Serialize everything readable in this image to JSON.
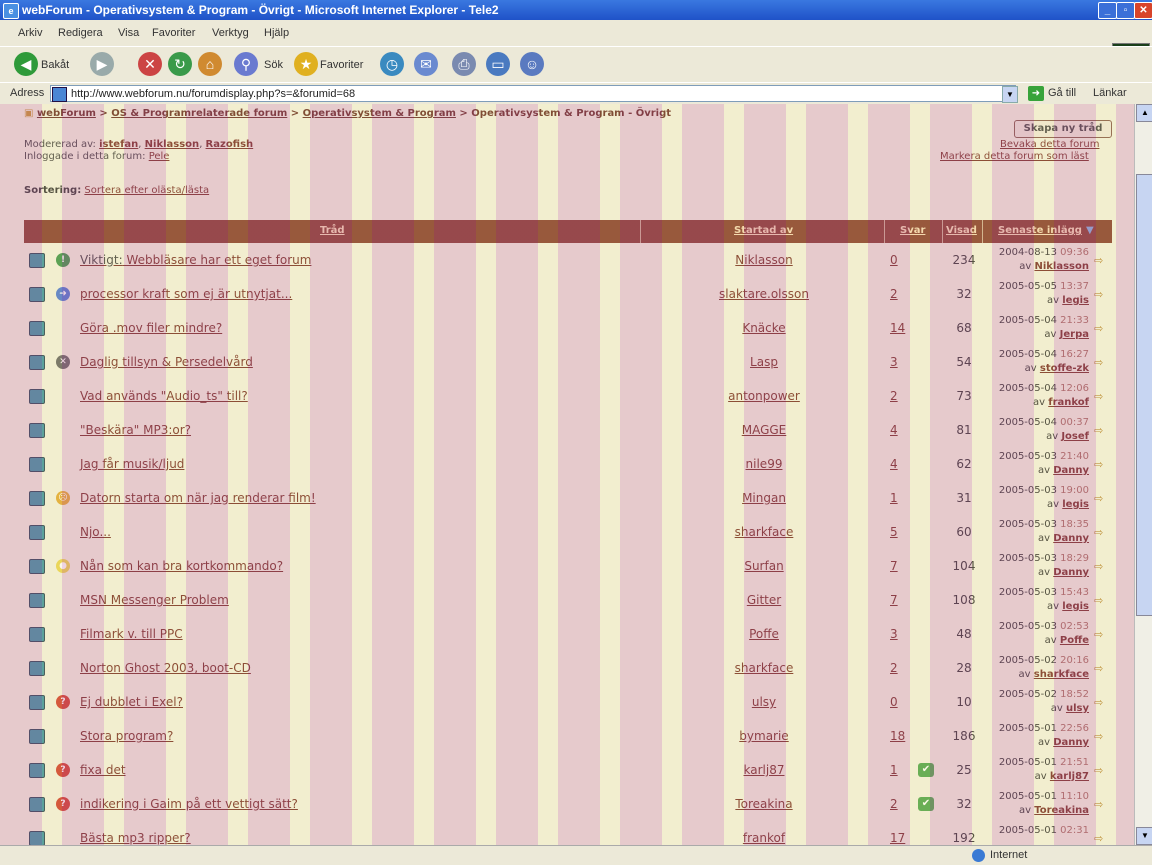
{
  "window": {
    "title": "webForum - Operativsystem & Program - Övrigt - Microsoft Internet Explorer - Tele2"
  },
  "menu": [
    "Arkiv",
    "Redigera",
    "Visa",
    "Favoriter",
    "Verktyg",
    "Hjälp"
  ],
  "toolbar": {
    "back_label": "Bakåt",
    "search_label": "Sök",
    "favorites_label": "Favoriter"
  },
  "address": {
    "label": "Adress",
    "url": "http://www.webforum.nu/forumdisplay.php?s=&forumid=68",
    "go_label": "Gå till",
    "links_label": "Länkar"
  },
  "breadcrumb": {
    "home": "webForum",
    "level1": "OS & Programrelaterade forum",
    "level2": "Operativsystem & Program",
    "current": "Operativsystem & Program - Övrigt"
  },
  "forum": {
    "moderated_label": "Modererad av:",
    "moderators": [
      "istefan",
      "Niklasson",
      "Razofish"
    ],
    "online_label": "Inloggade i detta forum:",
    "online_users": "Pele",
    "new_thread": "Skapa ny tråd",
    "watch_forum": "Bevaka detta forum",
    "mark_read": "Markera detta forum som läst",
    "sort_label": "Sortering:",
    "sort_value": "Sortera efter olästa/lästa"
  },
  "table": {
    "headers": {
      "thread": "Tråd",
      "started_by": "Startad av",
      "replies": "Svar",
      "views": "Visad",
      "last_post": "Senaste inlägg"
    },
    "rows": [
      {
        "icon": "exclaim-icon",
        "prefix": "Viktigt:",
        "title": "Webbläsare har ett eget forum",
        "starter": "Niklasson",
        "replies": "0",
        "views": "234",
        "date": "2004-08-13",
        "time": "09:36",
        "last_by": "Niklasson"
      },
      {
        "icon": "arrow-icon",
        "prefix": "",
        "title": "processor kraft som ej är utnytjat...",
        "starter": "slaktare.olsson",
        "replies": "2",
        "views": "32",
        "date": "2005-05-05",
        "time": "13:37",
        "last_by": "legis"
      },
      {
        "icon": "",
        "prefix": "",
        "title": "Göra .mov filer mindre?",
        "starter": "Knäcke",
        "replies": "14",
        "views": "68",
        "date": "2005-05-04",
        "time": "21:33",
        "last_by": "Jerpa"
      },
      {
        "icon": "tools-icon",
        "prefix": "",
        "title": "Daglig tillsyn & Persedelvård",
        "starter": "Lasp",
        "replies": "3",
        "views": "54",
        "date": "2005-05-04",
        "time": "16:27",
        "last_by": "stoffe-zk"
      },
      {
        "icon": "",
        "prefix": "",
        "title": "Vad används \"Audio_ts\" till?",
        "starter": "antonpower",
        "replies": "2",
        "views": "73",
        "date": "2005-05-04",
        "time": "12:06",
        "last_by": "frankof"
      },
      {
        "icon": "",
        "prefix": "",
        "title": "\"Beskära\" MP3:or?",
        "starter": "MAGGE",
        "replies": "4",
        "views": "81",
        "date": "2005-05-04",
        "time": "00:37",
        "last_by": "Josef"
      },
      {
        "icon": "",
        "prefix": "",
        "title": "Jag får musik/ljud",
        "starter": "nile99",
        "replies": "4",
        "views": "62",
        "date": "2005-05-03",
        "time": "21:40",
        "last_by": "Danny"
      },
      {
        "icon": "sad-icon",
        "prefix": "",
        "title": "Datorn starta om när jag renderar film!",
        "starter": "Mingan",
        "replies": "1",
        "views": "31",
        "date": "2005-05-03",
        "time": "19:00",
        "last_by": "legis"
      },
      {
        "icon": "",
        "prefix": "",
        "title": "Njo...",
        "starter": "sharkface",
        "replies": "5",
        "views": "60",
        "date": "2005-05-03",
        "time": "18:35",
        "last_by": "Danny"
      },
      {
        "icon": "bulb-icon",
        "prefix": "",
        "title": "Nån som kan bra kortkommando?",
        "starter": "Surfan",
        "replies": "7",
        "views": "104",
        "date": "2005-05-03",
        "time": "18:29",
        "last_by": "Danny"
      },
      {
        "icon": "",
        "prefix": "",
        "title": "MSN Messenger Problem",
        "starter": "Gitter",
        "replies": "7",
        "views": "108",
        "date": "2005-05-03",
        "time": "15:43",
        "last_by": "legis"
      },
      {
        "icon": "",
        "prefix": "",
        "title": "Filmark v. till PPC",
        "starter": "Poffe",
        "replies": "3",
        "views": "48",
        "date": "2005-05-03",
        "time": "02:53",
        "last_by": "Poffe"
      },
      {
        "icon": "",
        "prefix": "",
        "title": "Norton Ghost 2003, boot-CD",
        "starter": "sharkface",
        "replies": "2",
        "views": "28",
        "date": "2005-05-02",
        "time": "20:16",
        "last_by": "sharkface"
      },
      {
        "icon": "question-icon",
        "prefix": "",
        "title": "Ej dubblet i Exel?",
        "starter": "ulsy",
        "replies": "0",
        "views": "10",
        "date": "2005-05-02",
        "time": "18:52",
        "last_by": "ulsy"
      },
      {
        "icon": "",
        "prefix": "",
        "title": "Stora program?",
        "starter": "bymarie",
        "replies": "18",
        "views": "186",
        "date": "2005-05-01",
        "time": "22:56",
        "last_by": "Danny"
      },
      {
        "icon": "question-icon",
        "prefix": "",
        "title": "fixa det",
        "starter": "karlj87",
        "replies": "1",
        "views": "25",
        "date": "2005-05-01",
        "time": "21:51",
        "last_by": "karlj87"
      },
      {
        "icon": "question-icon",
        "prefix": "",
        "title": "indikering i Gaim på ett vettigt sätt?",
        "starter": "Toreakina",
        "replies": "2",
        "views": "32",
        "date": "2005-05-01",
        "time": "11:10",
        "last_by": "Toreakina"
      },
      {
        "icon": "",
        "prefix": "",
        "title": "Bästa mp3 ripper?",
        "starter": "frankof",
        "replies": "17",
        "views": "192",
        "date": "2005-05-01",
        "time": "02:31",
        "last_by": ""
      }
    ]
  },
  "status": {
    "zone": "Internet"
  }
}
